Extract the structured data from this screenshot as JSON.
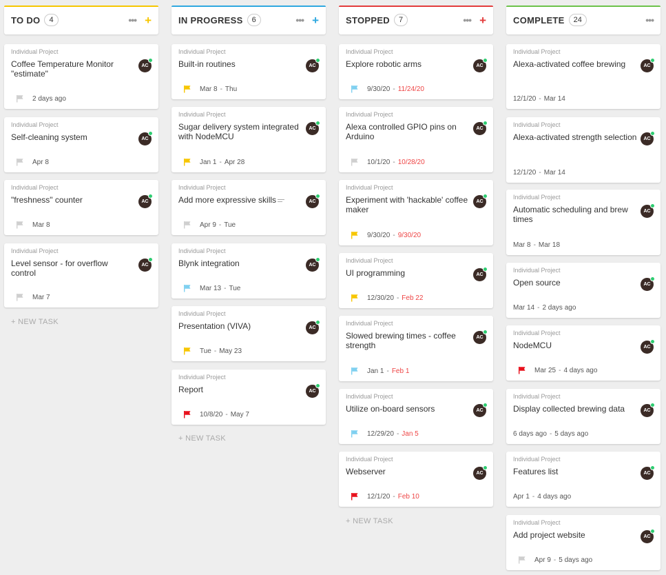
{
  "colors": {
    "todo": "#f7c600",
    "in_progress": "#2fa8e0",
    "stopped": "#e33b3b",
    "complete": "#6cc24a"
  },
  "columns": [
    {
      "title": "TO DO",
      "count": "4",
      "plus": "+",
      "tasks": [
        {
          "project": "Individual Project",
          "title": "Coffee Temperature Monitor \"estimate\"",
          "avatar": "AC",
          "flag": "gray",
          "start": "2 days ago",
          "end": "",
          "end_overdue": false
        },
        {
          "project": "Individual Project",
          "title": "Self-cleaning system",
          "avatar": "AC",
          "flag": "gray",
          "start": "Apr 8",
          "end": "",
          "end_overdue": false
        },
        {
          "project": "Individual Project",
          "title": "\"freshness\" counter",
          "avatar": "AC",
          "flag": "gray",
          "start": "Mar 8",
          "end": "",
          "end_overdue": false
        },
        {
          "project": "Individual Project",
          "title": "Level sensor - for overflow control",
          "avatar": "AC",
          "flag": "gray",
          "start": "Mar 7",
          "end": "",
          "end_overdue": false
        }
      ],
      "new_task": "+ NEW TASK"
    },
    {
      "title": "IN PROGRESS",
      "count": "6",
      "plus": "+",
      "tasks": [
        {
          "project": "Individual Project",
          "title": "Built-in routines",
          "avatar": "AC",
          "flag": "yellow",
          "start": "Mar 8",
          "end": "Thu",
          "end_overdue": false
        },
        {
          "project": "Individual Project",
          "title": "Sugar delivery system integrated with NodeMCU",
          "avatar": "AC",
          "flag": "yellow",
          "start": "Jan 1",
          "end": "Apr 28",
          "end_overdue": false
        },
        {
          "project": "Individual Project",
          "title": "Add more expressive skills",
          "avatar": "AC",
          "flag": "gray",
          "start": "Apr 9",
          "end": "Tue",
          "end_overdue": false,
          "has_description": true
        },
        {
          "project": "Individual Project",
          "title": "Blynk integration",
          "avatar": "AC",
          "flag": "blue",
          "start": "Mar 13",
          "end": "Tue",
          "end_overdue": false
        },
        {
          "project": "Individual Project",
          "title": "Presentation (VIVA)",
          "avatar": "AC",
          "flag": "yellow",
          "start": "Tue",
          "end": "May 23",
          "end_overdue": false
        },
        {
          "project": "Individual Project",
          "title": "Report",
          "avatar": "AC",
          "flag": "red",
          "start": "10/8/20",
          "end": "May 7",
          "end_overdue": false
        }
      ],
      "new_task": "+ NEW TASK"
    },
    {
      "title": "STOPPED",
      "count": "7",
      "plus": "+",
      "tasks": [
        {
          "project": "Individual Project",
          "title": "Explore robotic arms",
          "avatar": "AC",
          "flag": "blue",
          "start": "9/30/20",
          "end": "11/24/20",
          "end_overdue": true
        },
        {
          "project": "Individual Project",
          "title": "Alexa controlled GPIO pins on Arduino",
          "avatar": "AC",
          "flag": "gray",
          "start": "10/1/20",
          "end": "10/28/20",
          "end_overdue": true
        },
        {
          "project": "Individual Project",
          "title": "Experiment with 'hackable' coffee maker",
          "avatar": "AC",
          "flag": "yellow",
          "start": "9/30/20",
          "end": "9/30/20",
          "end_overdue": true
        },
        {
          "project": "Individual Project",
          "title": "UI programming",
          "avatar": "AC",
          "flag": "yellow",
          "start": "12/30/20",
          "end": "Feb 22",
          "end_overdue": true
        },
        {
          "project": "Individual Project",
          "title": "Slowed brewing times - coffee strength",
          "avatar": "AC",
          "flag": "blue",
          "start": "Jan 1",
          "end": "Feb 1",
          "end_overdue": true
        },
        {
          "project": "Individual Project",
          "title": "Utilize on-board sensors",
          "avatar": "AC",
          "flag": "blue",
          "start": "12/29/20",
          "end": "Jan 5",
          "end_overdue": true
        },
        {
          "project": "Individual Project",
          "title": "Webserver",
          "avatar": "AC",
          "flag": "red",
          "start": "12/1/20",
          "end": "Feb 10",
          "end_overdue": true
        }
      ],
      "new_task": "+ NEW TASK"
    },
    {
      "title": "COMPLETE",
      "count": "24",
      "plus": "",
      "tasks": [
        {
          "project": "Individual Project",
          "title": "Alexa-activated coffee brewing",
          "avatar": "AC",
          "flag": "none",
          "start": "12/1/20",
          "end": "Mar 14",
          "end_overdue": false
        },
        {
          "project": "Individual Project",
          "title": "Alexa-activated strength selection",
          "avatar": "AC",
          "flag": "none",
          "start": "12/1/20",
          "end": "Mar 14",
          "end_overdue": false
        },
        {
          "project": "Individual Project",
          "title": "Automatic scheduling and brew times",
          "avatar": "AC",
          "flag": "none",
          "start": "Mar 8",
          "end": "Mar 18",
          "end_overdue": false
        },
        {
          "project": "Individual Project",
          "title": "Open source",
          "avatar": "AC",
          "flag": "none",
          "start": "Mar 14",
          "end": "2 days ago",
          "end_overdue": false
        },
        {
          "project": "Individual Project",
          "title": "NodeMCU",
          "avatar": "AC",
          "flag": "red",
          "start": "Mar 25",
          "end": "4 days ago",
          "end_overdue": false
        },
        {
          "project": "Individual Project",
          "title": "Display collected brewing data",
          "avatar": "AC",
          "flag": "none",
          "start": "6 days ago",
          "end": "5 days ago",
          "end_overdue": false
        },
        {
          "project": "Individual Project",
          "title": "Features list",
          "avatar": "AC",
          "flag": "none",
          "start": "Apr 1",
          "end": "4 days ago",
          "end_overdue": false
        },
        {
          "project": "Individual Project",
          "title": "Add project website",
          "avatar": "AC",
          "flag": "gray",
          "start": "Apr 9",
          "end": "5 days ago",
          "end_overdue": false
        }
      ],
      "new_task": ""
    }
  ]
}
